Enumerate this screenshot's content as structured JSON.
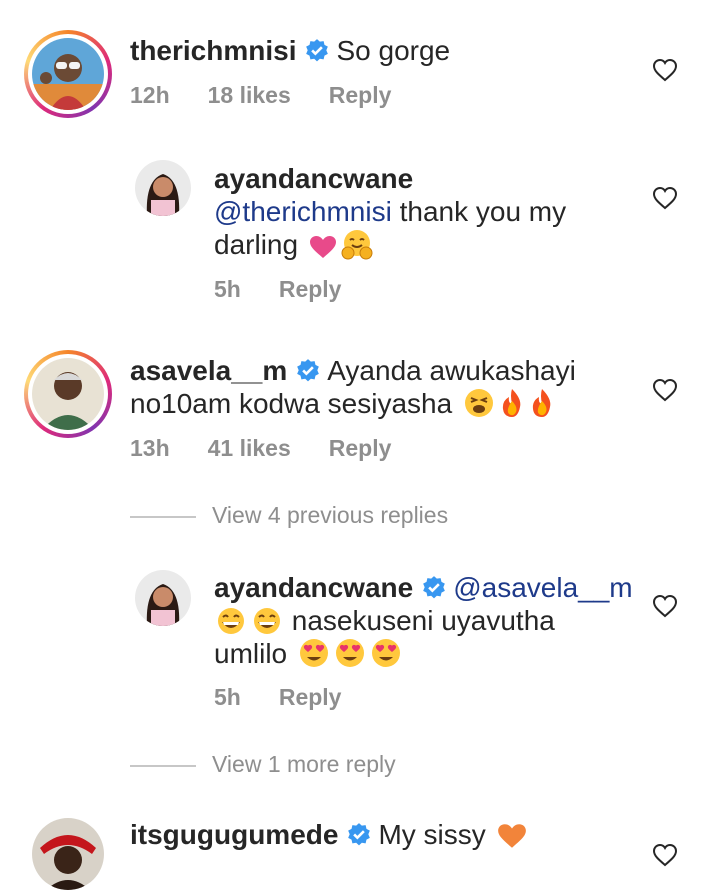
{
  "comments": [
    {
      "username": "therichmnisi",
      "verified": true,
      "text": "So gorge",
      "time": "12h",
      "likes": "18 likes",
      "reply": "Reply"
    },
    {
      "username": "ayandancwane",
      "verified": false,
      "mention": "@therichmnisi",
      "text": " thank you my darling",
      "time": "5h",
      "reply": "Reply"
    },
    {
      "username": "asavela__m",
      "verified": true,
      "text": "Ayanda awukashayi no10am kodwa sesiyasha",
      "time": "13h",
      "likes": "41 likes",
      "reply": "Reply"
    },
    {
      "view_replies": "View 4 previous replies"
    },
    {
      "username": "ayandancwane",
      "verified": true,
      "mention": "@asavela__m",
      "text": " nasekuseni uyavutha umlilo",
      "time": "5h",
      "reply": "Reply"
    },
    {
      "view_replies": "View 1 more reply"
    },
    {
      "username": "itsgugugumede",
      "verified": true,
      "text": "My sissy"
    }
  ],
  "colors": {
    "mention": "#1e3a8a",
    "verified": "#3897f0",
    "meta": "#8e8e8e"
  },
  "icons": [
    "heart-outline-icon",
    "verified-badge-icon"
  ]
}
